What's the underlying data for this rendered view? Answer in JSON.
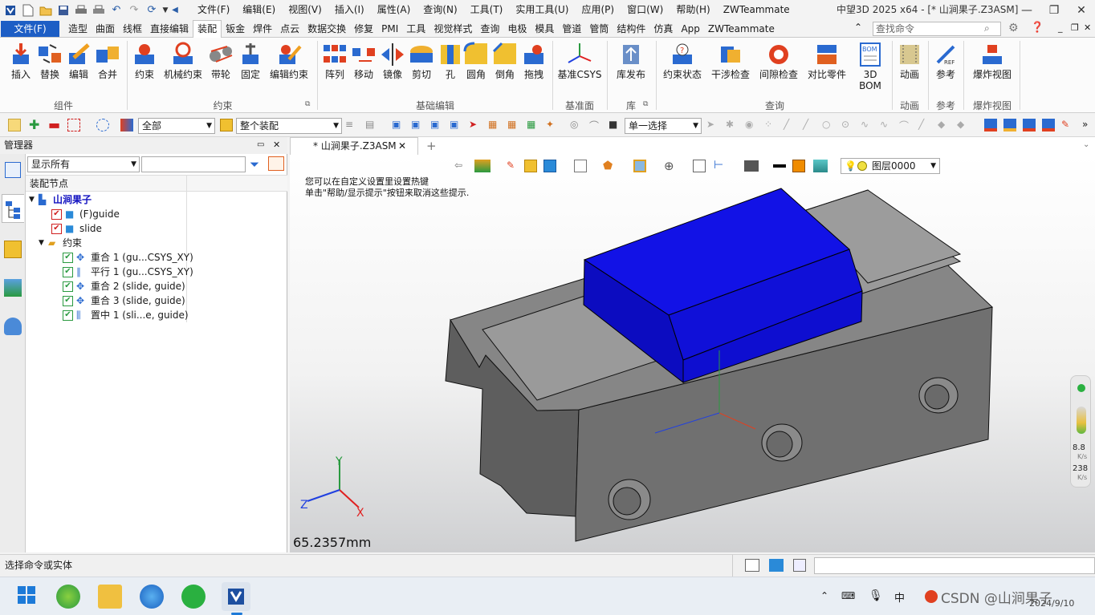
{
  "app": {
    "window_title": "中望3D 2025 x64 - [* 山涧果子.Z3ASM]",
    "menu": [
      "文件(F)",
      "编辑(E)",
      "视图(V)",
      "插入(I)",
      "属性(A)",
      "查询(N)",
      "工具(T)",
      "实用工具(U)",
      "应用(P)",
      "窗口(W)",
      "帮助(H)",
      "ZWTeammate"
    ]
  },
  "ribbon_tabs": {
    "file": "文件(F)",
    "tabs": [
      "造型",
      "曲面",
      "线框",
      "直接编辑",
      "装配",
      "钣金",
      "焊件",
      "点云",
      "数据交换",
      "修复",
      "PMI",
      "工具",
      "视觉样式",
      "查询",
      "电极",
      "模具",
      "管道",
      "管筒",
      "结构件",
      "仿真",
      "App",
      "ZWTeammate"
    ],
    "active": "装配",
    "search_placeholder": "查找命令"
  },
  "ribbon": {
    "groups": {
      "component": {
        "label": "组件",
        "buttons": [
          "插入",
          "替换",
          "编辑",
          "合并"
        ]
      },
      "constraint": {
        "label": "约束",
        "buttons": [
          "约束",
          "机械约束",
          "带轮",
          "固定",
          "编辑约束"
        ]
      },
      "basic_edit": {
        "label": "基础编辑",
        "buttons": [
          "阵列",
          "移动",
          "镜像",
          "剪切",
          "孔",
          "圆角",
          "倒角",
          "拖拽"
        ]
      },
      "datum": {
        "label": "基准面",
        "buttons": [
          "基准CSYS"
        ]
      },
      "library": {
        "label": "库",
        "buttons": [
          "库发布"
        ]
      },
      "query": {
        "label": "查询",
        "buttons": [
          "约束状态",
          "干涉检查",
          "间隙检查",
          "对比零件",
          "3D BOM"
        ]
      },
      "animation": {
        "label": "动画",
        "buttons": [
          "动画"
        ]
      },
      "reference": {
        "label": "参考",
        "buttons": [
          "参考"
        ]
      },
      "exploded": {
        "label": "爆炸视图",
        "buttons": [
          "爆炸视图"
        ]
      }
    }
  },
  "toolbar": {
    "filter_value": "全部",
    "assembly_value": "整个装配",
    "select_mode": "单一选择"
  },
  "manager": {
    "title": "管理器",
    "display_filter": "显示所有",
    "column_header": "装配节点",
    "tree": [
      {
        "label": "山涧果子"
      },
      {
        "label": "(F)guide"
      },
      {
        "label": "slide"
      },
      {
        "label": "约束"
      },
      {
        "label": "重合 1 (gu...CSYS_XY)"
      },
      {
        "label": "平行 1 (gu...CSYS_XY)"
      },
      {
        "label": "重合 2 (slide, guide)"
      },
      {
        "label": "重合 3 (slide, guide)"
      },
      {
        "label": "置中 1 (sli...e, guide)"
      }
    ]
  },
  "document": {
    "tab_title": "* 山涧果子.Z3ASM",
    "hint_line1": "您可以在自定义设置里设置热键",
    "hint_line2": "单击\"帮助/显示提示\"按钮来取消这些提示.",
    "layer": "图层0000",
    "scale_readout": "65.2357mm",
    "axis_labels": {
      "x": "X",
      "y": "Y",
      "z": "Z"
    }
  },
  "net_widget": {
    "up_value": "8.8",
    "up_unit": "K/s",
    "down_value": "238",
    "down_unit": "K/s"
  },
  "status": {
    "prompt": "选择命令或实体"
  },
  "taskbar": {
    "watermark": "CSDN @山涧果子",
    "date": "2024/9/10"
  },
  "colors": {
    "accent": "#1d5ec5",
    "slide_part": "#1010e0",
    "guide_part": "#6f6f6f"
  }
}
